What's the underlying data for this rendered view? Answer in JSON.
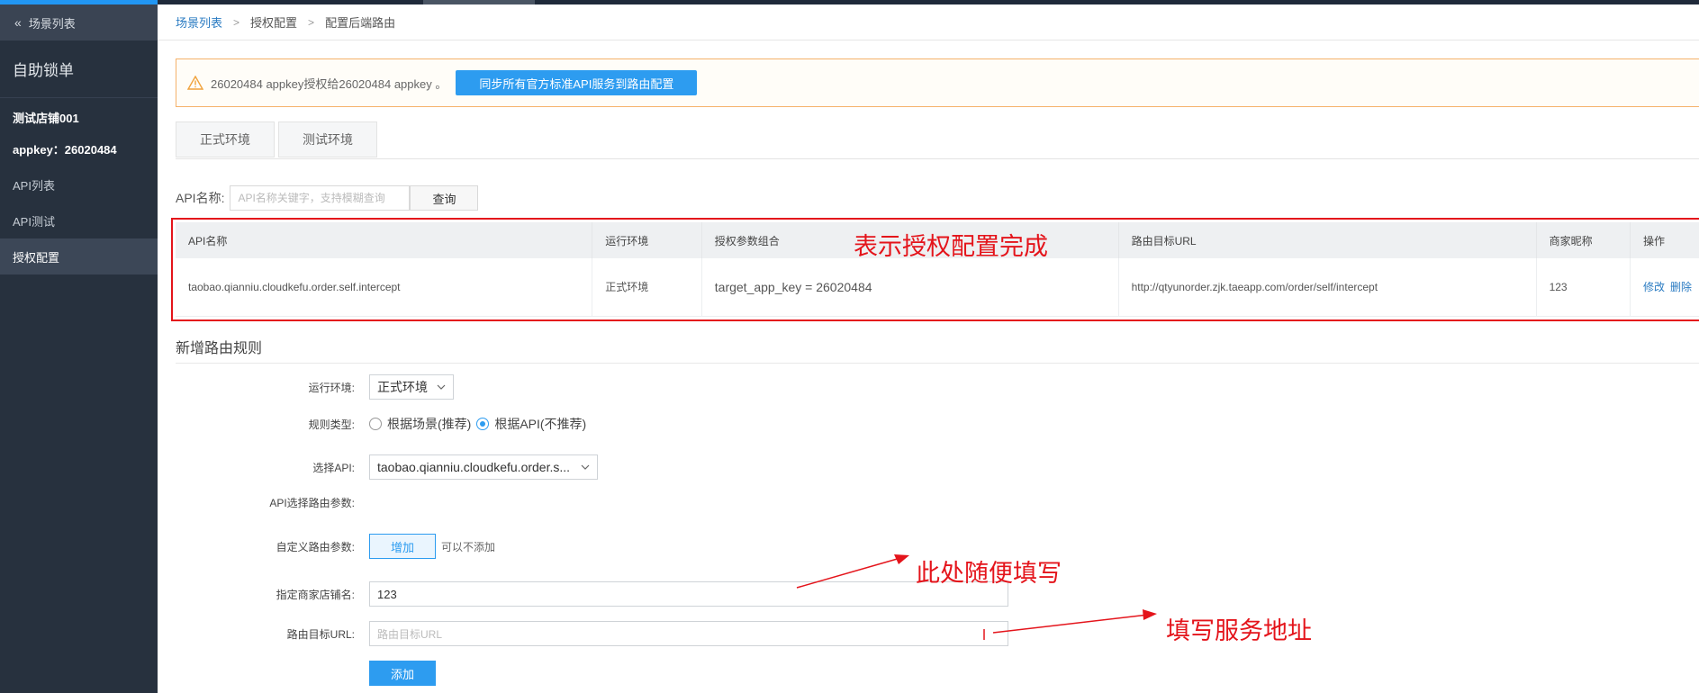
{
  "sidebar": {
    "back_label": "场景列表",
    "title": "自助锁单",
    "shop_name": "测试店铺001",
    "appkey_line": "appkey：26020484",
    "nav": [
      {
        "label": "API列表"
      },
      {
        "label": "API测试"
      },
      {
        "label": "授权配置"
      }
    ]
  },
  "breadcrumb": {
    "items": [
      "场景列表",
      "授权配置",
      "配置后端路由"
    ]
  },
  "notice": {
    "text": "26020484 appkey授权给26020484 appkey 。",
    "button_label": "同步所有官方标准API服务到路由配置"
  },
  "tabs": [
    "正式环境",
    "测试环境"
  ],
  "search": {
    "label": "API名称:",
    "placeholder": "API名称关键字，支持模糊查询",
    "button_label": "查询"
  },
  "table": {
    "headers": [
      "API名称",
      "运行环境",
      "授权参数组合",
      "路由目标URL",
      "商家昵称",
      "操作"
    ],
    "rows": [
      {
        "api": "taobao.qianniu.cloudkefu.order.self.intercept",
        "env": "正式环境",
        "params": "target_app_key = 26020484",
        "url": "http://qtyunorder.zjk.taeapp.com/order/self/intercept",
        "nick": "123",
        "action_edit": "修改",
        "action_delete": "删除"
      }
    ]
  },
  "annotations": {
    "done": "表示授权配置完成",
    "fill_any": "此处随便填写",
    "fill_addr": "填写服务地址"
  },
  "form": {
    "title": "新增路由规则",
    "env_label": "运行环境:",
    "env_value": "正式环境",
    "rule_label": "规则类型:",
    "rule_option_scene": "根据场景(推荐)",
    "rule_option_api": "根据API(不推荐)",
    "api_label": "选择API:",
    "api_value": "taobao.qianniu.cloudkefu.order.s...",
    "api_params_label": "API选择路由参数:",
    "custom_label": "自定义路由参数:",
    "custom_button": "增加",
    "custom_hint": "可以不添加",
    "shop_label": "指定商家店铺名:",
    "shop_value": "123",
    "url_label": "路由目标URL:",
    "url_placeholder": "路由目标URL",
    "submit_label": "添加"
  },
  "colors": {
    "primary": "#2d9cf0",
    "annotation": "#e4141b",
    "sidebar_bg": "#27313e",
    "warning_border": "#f5b26b"
  }
}
